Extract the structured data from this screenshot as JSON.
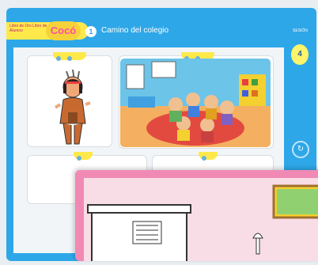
{
  "header": {
    "brand_text": "Libro de Oro Libro de Alumno",
    "logo_text": "Cocó",
    "unit_number": "1",
    "title": "Camino del colegio"
  },
  "side": {
    "label": "SESIÓN",
    "counter": "4"
  },
  "icons": {
    "next": "arrow-right-icon",
    "speaker": "speaker-icon"
  }
}
